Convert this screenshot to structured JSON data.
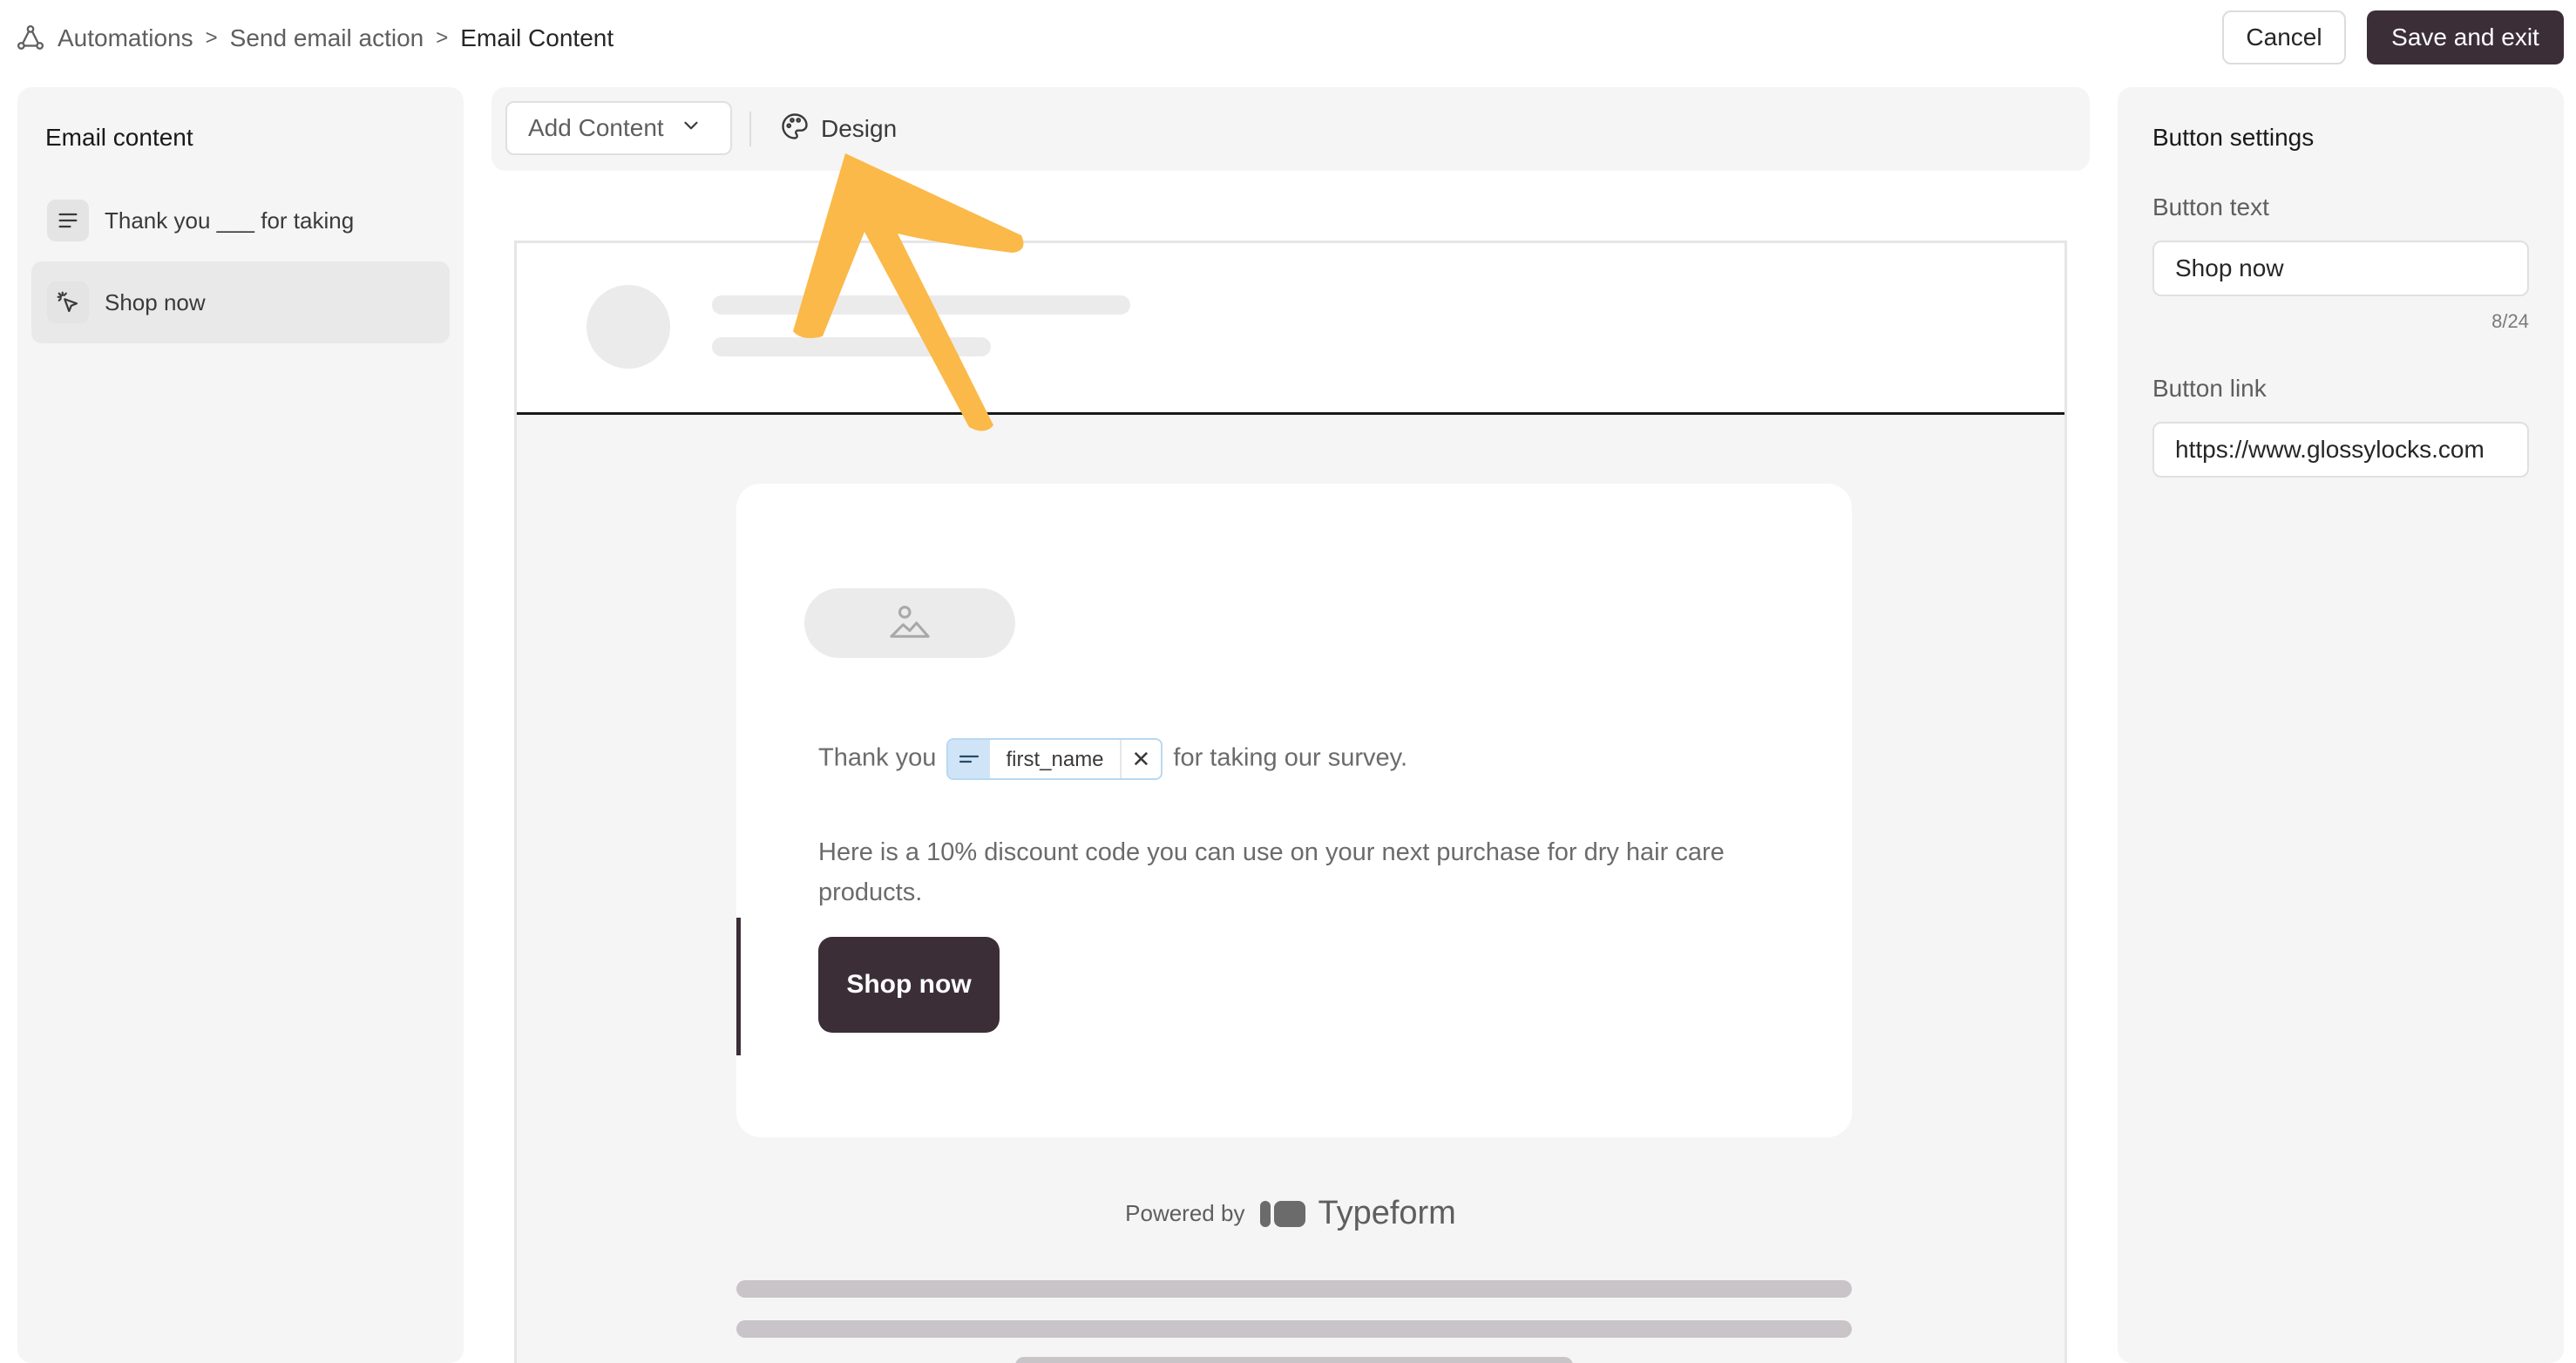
{
  "breadcrumb": {
    "items": [
      "Automations",
      "Send email action",
      "Email Content"
    ],
    "separators": [
      ">",
      ">"
    ]
  },
  "header": {
    "cancel_label": "Cancel",
    "save_label": "Save and exit"
  },
  "left_panel": {
    "title": "Email content",
    "items": [
      {
        "label": "Thank you ___ for taking",
        "icon": "text-lines-icon",
        "active": false
      },
      {
        "label": "Shop now",
        "icon": "click-cursor-icon",
        "active": true
      }
    ]
  },
  "toolbar": {
    "add_content_label": "Add Content",
    "design_label": "Design"
  },
  "email": {
    "text_prefix": "Thank you",
    "variable_name": "first_name",
    "variable_remove": "✕",
    "text_suffix": "for taking our survey.",
    "paragraph": "Here is a 10% discount code you can use on your next purchase for dry hair care products.",
    "button_label": "Shop now",
    "powered_by": "Powered by",
    "brand": "Typeform"
  },
  "right_panel": {
    "title": "Button settings",
    "button_text_label": "Button text",
    "button_text_value": "Shop now",
    "button_text_counter": "8/24",
    "button_link_label": "Button link",
    "button_link_value": "https://www.glossylocks.com"
  },
  "colors": {
    "brand_dark": "#3b2e37",
    "highlight_arrow": "#fbb949",
    "chip_accent": "#cfe5f7"
  }
}
